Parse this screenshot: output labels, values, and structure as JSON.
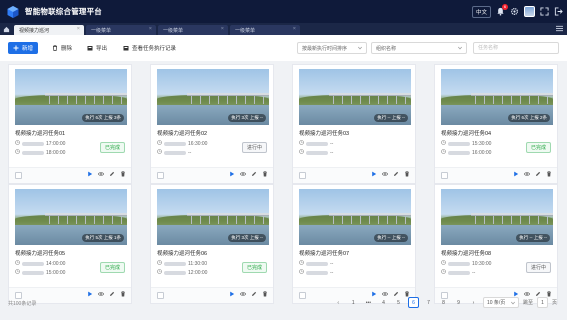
{
  "app": {
    "title": "智能物联综合管理平台"
  },
  "header": {
    "lang": "中文",
    "badge_count": "6"
  },
  "tabs": [
    {
      "label": "视频接力巡河",
      "active": true
    },
    {
      "label": "一级菜单",
      "active": false
    },
    {
      "label": "一级菜单",
      "active": false
    },
    {
      "label": "一级菜单",
      "active": false
    }
  ],
  "toolbar": {
    "new_label": "新增",
    "delete_label": "删除",
    "export_label": "导出",
    "view_records_label": "查看任务执行记录",
    "sort_select": "按最新执行时间排序",
    "org_select": "组织名称",
    "search_placeholder": "任务名称"
  },
  "cards": [
    {
      "name": "视频接力巡河任务01",
      "overlay": "执行 6次  上报 3条",
      "time1": "17:00:00",
      "time2": "18:00:00",
      "status": "已完成",
      "status_type": "done"
    },
    {
      "name": "视频接力巡河任务02",
      "overlay": "执行 3次  上报 --",
      "time1": "16:30:00",
      "time2": "--",
      "status": "进行中",
      "status_type": "run"
    },
    {
      "name": "视频接力巡河任务03",
      "overlay": "执行 --  上报 --",
      "time1": "--",
      "time2": "--",
      "status": "",
      "status_type": ""
    },
    {
      "name": "视频接力巡河任务04",
      "overlay": "执行 6次  上报 2条",
      "time1": "15:30:00",
      "time2": "16:00:00",
      "status": "已完成",
      "status_type": "done"
    },
    {
      "name": "视频接力巡河任务05",
      "overlay": "执行 5次  上报 1条",
      "time1": "14:00:00",
      "time2": "15:00:00",
      "status": "已完成",
      "status_type": "done"
    },
    {
      "name": "视频接力巡河任务06",
      "overlay": "执行 3次  上报 --",
      "time1": "11:30:00",
      "time2": "12:00:00",
      "status": "已完成",
      "status_type": "done"
    },
    {
      "name": "视频接力巡河任务07",
      "overlay": "执行 --  上报 --",
      "time1": "--",
      "time2": "--",
      "status": "",
      "status_type": ""
    },
    {
      "name": "视频接力巡河任务08",
      "overlay": "执行 --  上报 --",
      "time1": "10:30:00",
      "time2": "--",
      "status": "进行中",
      "status_type": "run"
    }
  ],
  "footer": {
    "total": "共100条记录",
    "pages": [
      "1",
      "•••",
      "4",
      "5",
      "6",
      "7",
      "8",
      "9"
    ],
    "current_page": "6",
    "page_size": "10 条/页",
    "goto_label": "跳至",
    "goto_value": "1",
    "goto_suffix": "页"
  }
}
